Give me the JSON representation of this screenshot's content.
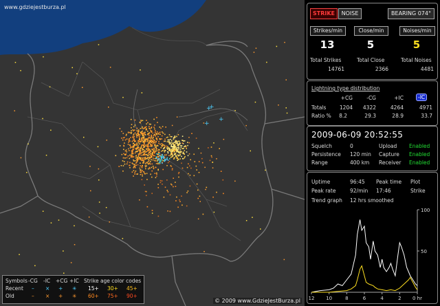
{
  "watermark": "www.gdziejestburza.pl",
  "copyright": "© 2009 www.GdzieJestBurza.pl",
  "buttons": {
    "strike": "STRIKE",
    "noise": "NOISE",
    "bearing": "BEARING 074°"
  },
  "rates": {
    "strikes_label": "Strikes/min",
    "close_label": "Close/min",
    "noises_label": "Noises/min",
    "strikes": "13",
    "close": "5",
    "noises": "5"
  },
  "totals": {
    "strikes_label": "Total Strikes",
    "close_label": "Total Close",
    "noises_label": "Total Noises",
    "strikes": "14761",
    "close": "2366",
    "noises": "4481"
  },
  "distribution": {
    "title": "Lightning type distribution",
    "headers": [
      "+CG",
      "-CG",
      "+IC",
      "-IC"
    ],
    "totals_label": "Totals",
    "totals": [
      "1204",
      "4322",
      "4264",
      "4971"
    ],
    "ratio_label": "Ratio %",
    "ratio": [
      "8.2",
      "29.3",
      "28.9",
      "33.7"
    ]
  },
  "datetime": "2009-06-09 20:52:55",
  "settings": {
    "squelch_label": "Squelch",
    "squelch": "0",
    "persistence_label": "Persistence",
    "persistence": "120 min",
    "range_label": "Range",
    "range": "400 km",
    "upload_label": "Upload",
    "upload": "Enabled",
    "capture_label": "Capture",
    "capture": "Enabled",
    "receiver_label": "Receiver",
    "receiver": "Enabled"
  },
  "stats": {
    "uptime_label": "Uptime",
    "uptime": "96:45",
    "peak_time_label": "Peak time",
    "peak_time": "17:46",
    "plot_label": "Plot",
    "peak_rate_label": "Peak rate",
    "peak_rate": "92/min",
    "strike_label": "Strike",
    "trend_label": "Trend graph",
    "trend": "12 hrs smoothed"
  },
  "legend": {
    "symbols_label": "Symbols",
    "cg_neg": "-CG",
    "ic_neg": "-IC",
    "cg_pos": "+CG",
    "ic_pos": "+IC",
    "age_label": "Strike age color codes",
    "recent_label": "Recent",
    "old_label": "Old",
    "recent_ages": [
      "15+",
      "30+",
      "45+"
    ],
    "old_ages": [
      "60+",
      "75+",
      "90+"
    ],
    "recent_marks": [
      "–",
      "×",
      "+",
      "✳"
    ],
    "old_marks": [
      "–",
      "×",
      "+",
      "✳"
    ]
  },
  "chart_data": {
    "type": "line",
    "x_ticks": [
      "12",
      "10",
      "8",
      "6",
      "4",
      "2",
      "0 hr"
    ],
    "y_ticks": [
      "100",
      "50"
    ],
    "xlim": [
      12,
      0
    ],
    "ylim": [
      0,
      100
    ],
    "series": [
      {
        "color": "#ffffff",
        "x": [
          12,
          11,
          10,
          9.5,
          9,
          8.5,
          8,
          7.5,
          7,
          6.8,
          6.5,
          6.3,
          6,
          5.8,
          5.5,
          5.3,
          5,
          4.8,
          4.5,
          4.2,
          4,
          3.8,
          3.5,
          3.2,
          3,
          2.8,
          2.5,
          2.2,
          2,
          1.8,
          1.5,
          1.2,
          1,
          0.8,
          0.5,
          0.2,
          0
        ],
        "y": [
          0,
          2,
          3,
          5,
          10,
          8,
          15,
          22,
          45,
          70,
          88,
          75,
          80,
          60,
          55,
          40,
          62,
          50,
          45,
          30,
          40,
          30,
          25,
          30,
          35,
          28,
          20,
          45,
          60,
          55,
          45,
          30,
          25,
          20,
          15,
          10,
          8
        ]
      },
      {
        "color": "#ffe020",
        "x": [
          12,
          10,
          9,
          8,
          7.5,
          7,
          6.8,
          6.5,
          6.3,
          6,
          5.8,
          5.5,
          5,
          4.8,
          4.5,
          4,
          3.5,
          3,
          2.5,
          2,
          1.5,
          1,
          0.8,
          0.5,
          0.2,
          0
        ],
        "y": [
          0,
          0,
          1,
          2,
          4,
          8,
          15,
          28,
          32,
          20,
          12,
          10,
          8,
          6,
          4,
          3,
          2,
          3,
          2,
          5,
          10,
          15,
          18,
          12,
          6,
          3
        ]
      }
    ]
  },
  "colors": {
    "sea": "#123f7e",
    "land": "#343434",
    "border": "#6e6e6e",
    "province": "#555555"
  }
}
